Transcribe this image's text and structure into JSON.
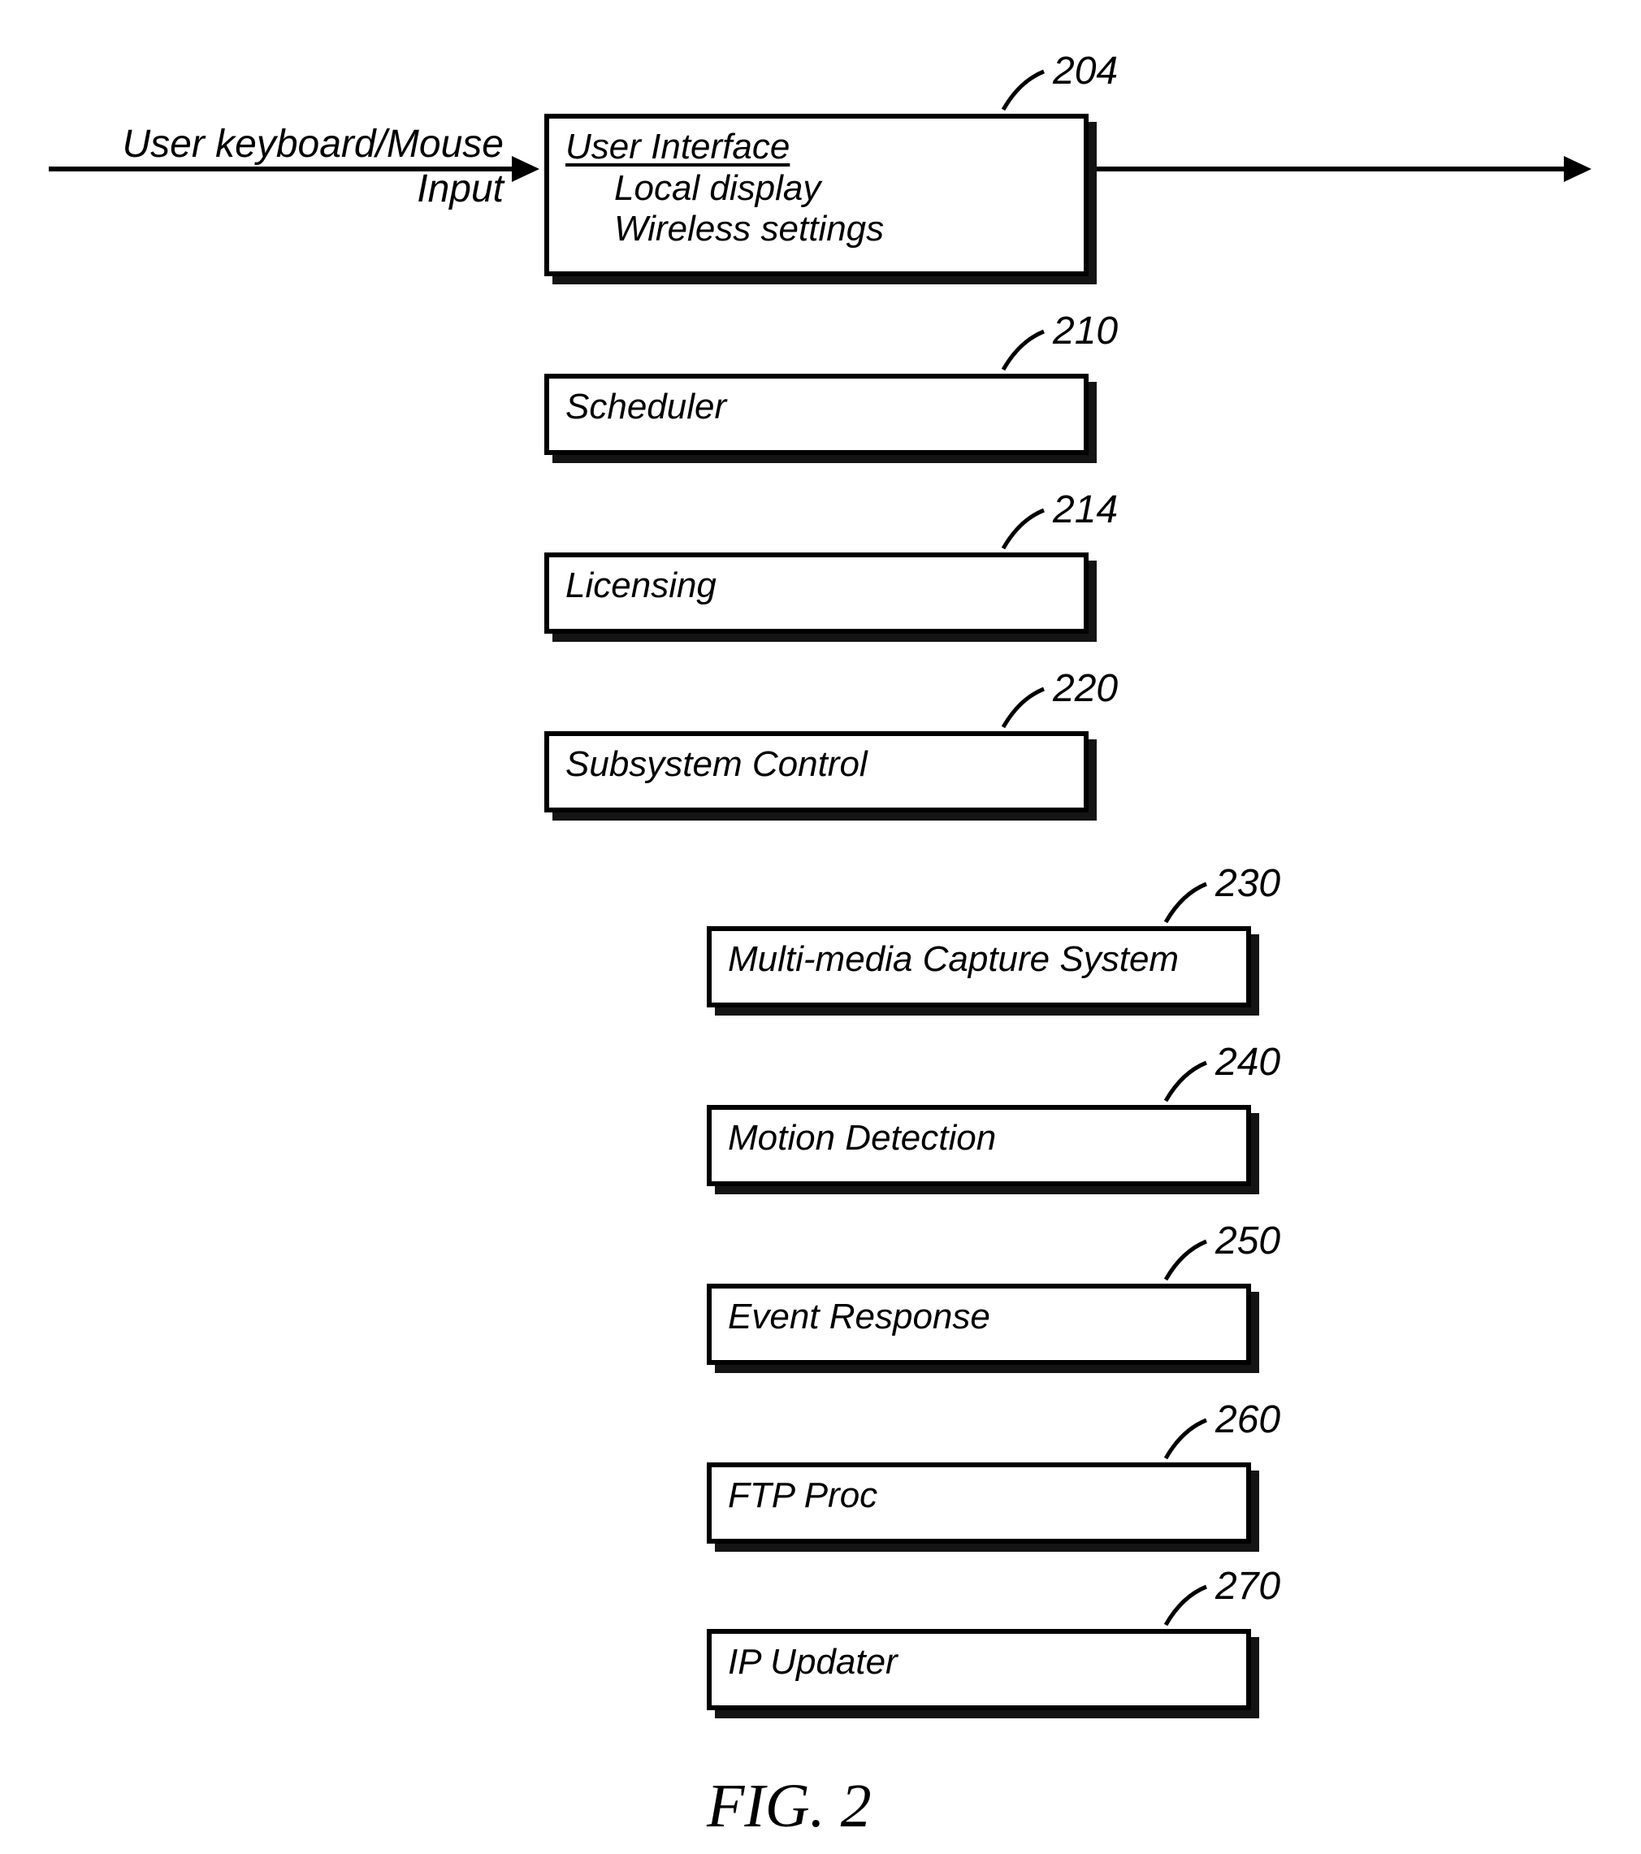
{
  "input_label": "User keyboard/Mouse Input",
  "boxes": {
    "ui": {
      "ref": "204",
      "title": "User Interface",
      "sub1": "Local display",
      "sub2": "Wireless settings"
    },
    "scheduler": {
      "ref": "210",
      "label": "Scheduler"
    },
    "licensing": {
      "ref": "214",
      "label": "Licensing"
    },
    "subsystem": {
      "ref": "220",
      "label": "Subsystem Control"
    },
    "capture": {
      "ref": "230",
      "label": "Multi-media Capture System"
    },
    "motion": {
      "ref": "240",
      "label": "Motion Detection"
    },
    "event": {
      "ref": "250",
      "label": "Event Response"
    },
    "ftp": {
      "ref": "260",
      "label": "FTP Proc"
    },
    "ip": {
      "ref": "270",
      "label": "IP Updater"
    }
  },
  "figure_caption": "FIG. 2"
}
